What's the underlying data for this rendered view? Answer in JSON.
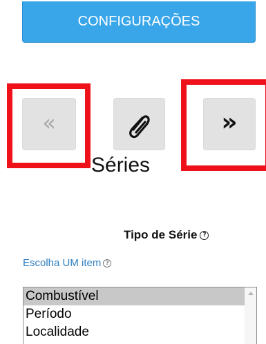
{
  "toolbar": {
    "config_label": "CONFIGURAÇÕES",
    "prev_glyph": "«",
    "next_glyph": "»",
    "clip_icon": "paperclip-icon"
  },
  "series": {
    "title": "Séries",
    "type_label": "Tipo de Série",
    "choose_label": "Escolha UM item",
    "help_glyph": "?",
    "options": [
      "Combustível",
      "Período",
      "Localidade"
    ],
    "selected_option": "Combustível"
  },
  "colors": {
    "config_button": "#3aa6ea",
    "highlight": "#ee1119",
    "link_text": "#2f7fc0",
    "nav_button": "#e2e2e2"
  }
}
